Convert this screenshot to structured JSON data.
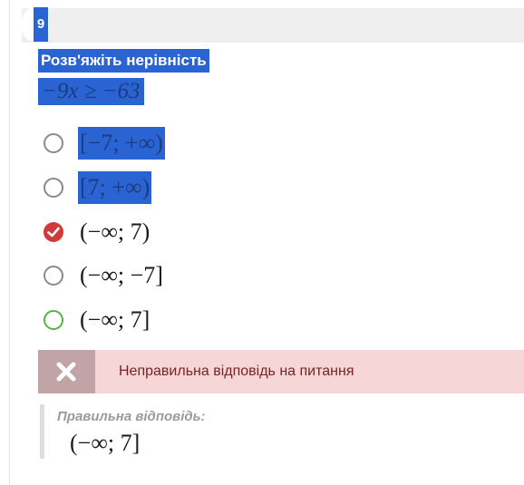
{
  "question": {
    "number": "9",
    "title": "Розв'яжіть нерівність",
    "inequality": "−9x ≥ −63"
  },
  "options": [
    {
      "label": "[−7; +∞)",
      "state": "unselected"
    },
    {
      "label": "[7; +∞)",
      "state": "unselected"
    },
    {
      "label": "(−∞; 7)",
      "state": "selected-incorrect"
    },
    {
      "label": "(−∞; −7]",
      "state": "unselected"
    },
    {
      "label": "(−∞; 7]",
      "state": "correct"
    }
  ],
  "feedback": {
    "icon": "cross-icon",
    "text": "Неправильна відповідь на питання"
  },
  "correct_answer": {
    "label": "Правильна відповідь:",
    "value": "(−∞; 7]"
  },
  "colors": {
    "highlight": "#2a64d2",
    "wrong": "#d13a3a",
    "correct": "#56b246",
    "feedback_bg": "#f7d6d8"
  }
}
